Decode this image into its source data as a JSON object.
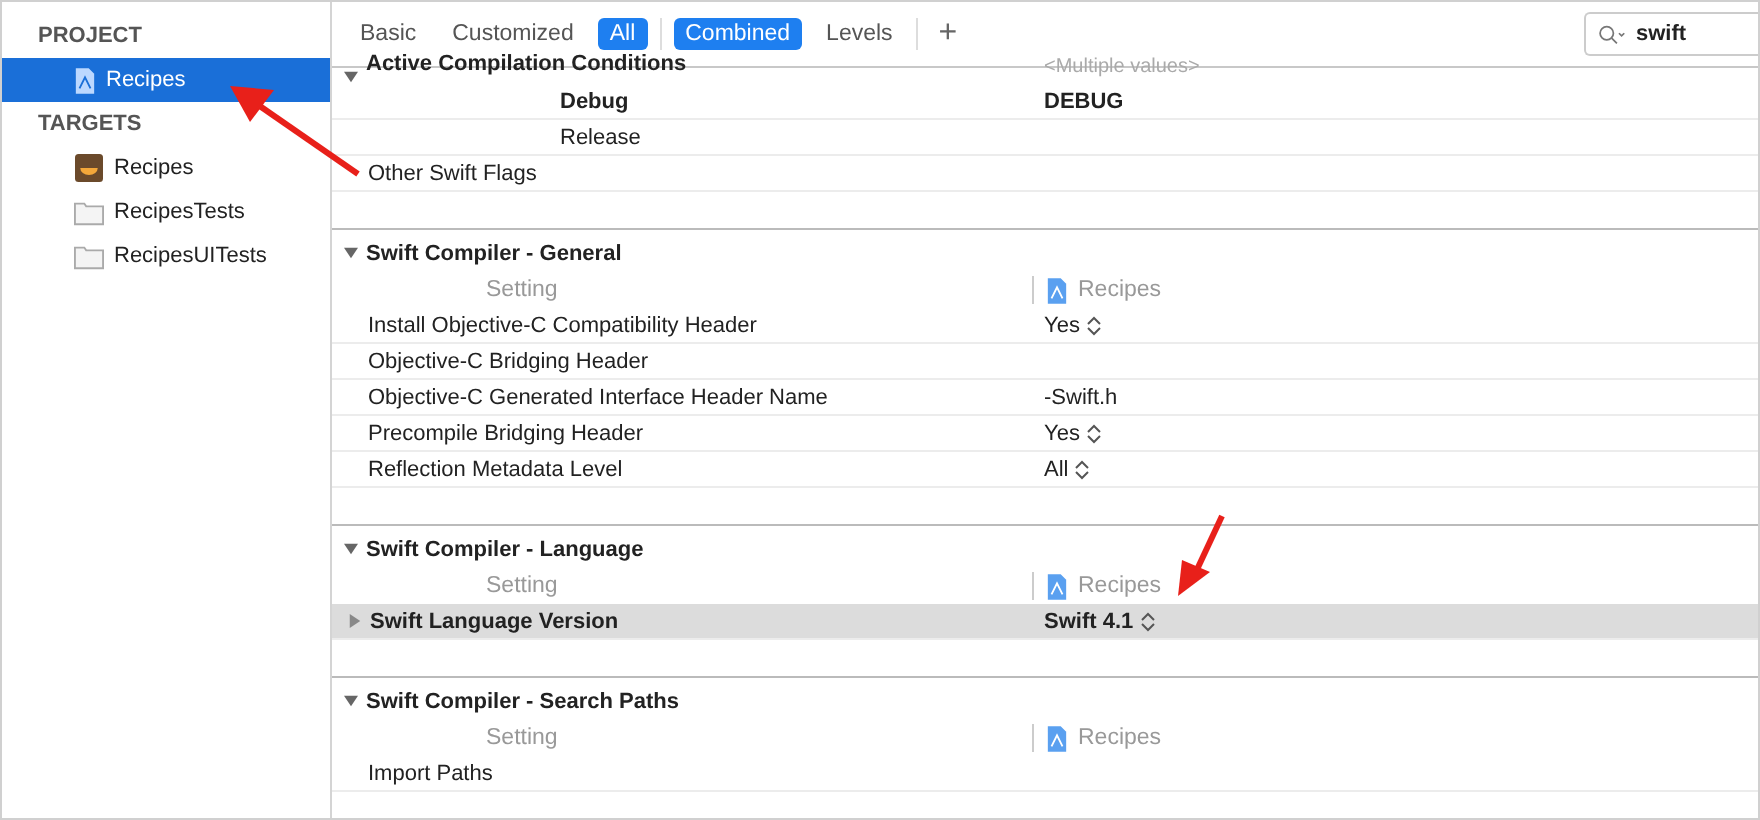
{
  "sidebar": {
    "groups": [
      {
        "heading": "PROJECT",
        "items": [
          {
            "label": "Recipes",
            "kind": "project",
            "selected": true
          }
        ]
      },
      {
        "heading": "TARGETS",
        "items": [
          {
            "label": "Recipes",
            "kind": "app",
            "selected": false
          },
          {
            "label": "RecipesTests",
            "kind": "bundle",
            "selected": false
          },
          {
            "label": "RecipesUITests",
            "kind": "bundle",
            "selected": false
          }
        ]
      }
    ]
  },
  "toolbar": {
    "filters": [
      {
        "label": "Basic",
        "selected": false
      },
      {
        "label": "Customized",
        "selected": false
      },
      {
        "label": "All",
        "selected": true
      }
    ],
    "views": [
      {
        "label": "Combined",
        "selected": true
      },
      {
        "label": "Levels",
        "selected": false
      }
    ],
    "add_button": "+",
    "search": {
      "value": "swift"
    }
  },
  "sections": [
    {
      "title": "Active Compilation Conditions",
      "title_value": "<Multiple values>",
      "rows": [
        {
          "kind": "condition",
          "setting": "Debug",
          "value": "DEBUG",
          "customized": true,
          "selected": false
        },
        {
          "kind": "condition",
          "setting": "Release",
          "customized": false,
          "selected": false
        },
        {
          "kind": "setting",
          "setting": "Other Swift Flags",
          "customized": false,
          "selected": false
        }
      ]
    },
    {
      "title": "Swift Compiler - General",
      "header": {
        "setting": "Setting",
        "target": "Recipes"
      },
      "rows": [
        {
          "kind": "setting",
          "setting": "Install Objective-C Compatibility Header",
          "value": "Yes",
          "popup": true,
          "customized": false,
          "selected": false
        },
        {
          "kind": "setting",
          "setting": "Objective-C Bridging Header",
          "customized": false,
          "selected": false
        },
        {
          "kind": "setting",
          "setting": "Objective-C Generated Interface Header Name",
          "value": "-Swift.h",
          "customized": false,
          "selected": false
        },
        {
          "kind": "setting",
          "setting": "Precompile Bridging Header",
          "value": "Yes",
          "popup": true,
          "customized": false,
          "selected": false
        },
        {
          "kind": "setting",
          "setting": "Reflection Metadata Level",
          "value": "All",
          "popup": true,
          "customized": false,
          "selected": false
        }
      ]
    },
    {
      "title": "Swift Compiler - Language",
      "header": {
        "setting": "Setting",
        "target": "Recipes"
      },
      "rows": [
        {
          "kind": "group",
          "setting": "Swift Language Version",
          "value": "Swift 4.1",
          "popup": true,
          "expanded": false,
          "customized": true,
          "selected": true
        }
      ]
    },
    {
      "title": "Swift Compiler - Search Paths",
      "header": {
        "setting": "Setting",
        "target": "Recipes"
      },
      "rows": [
        {
          "kind": "setting",
          "setting": "Import Paths",
          "customized": false,
          "selected": false
        }
      ]
    }
  ]
}
